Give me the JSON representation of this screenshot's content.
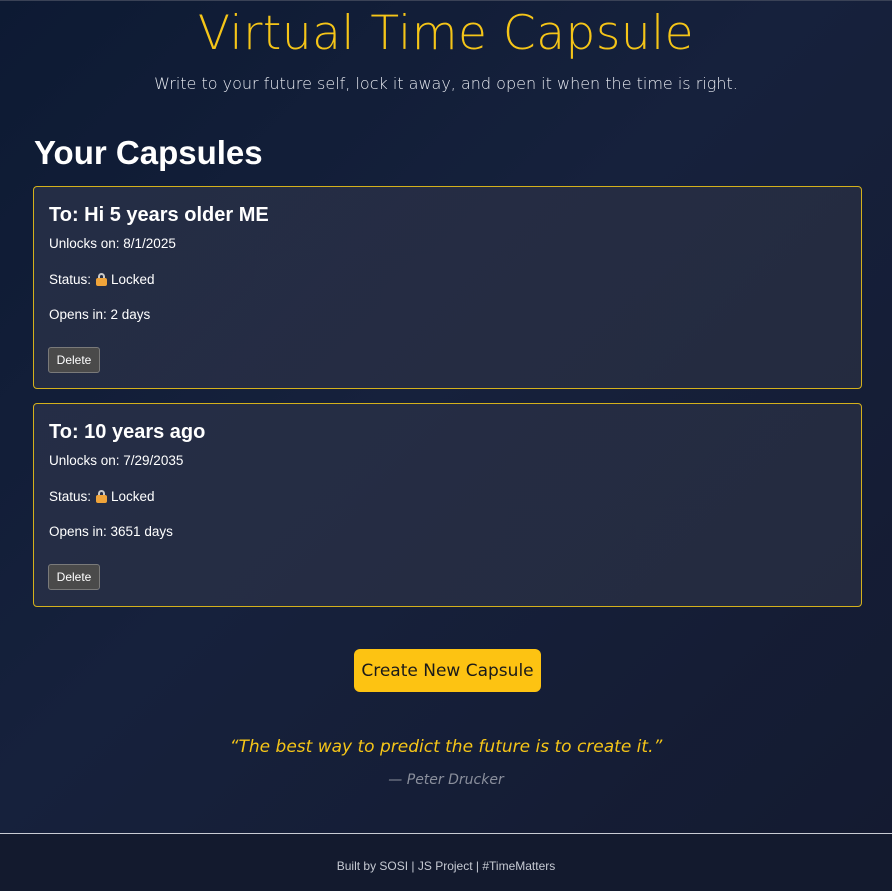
{
  "header": {
    "title": "Virtual Time Capsule",
    "subtitle": "Write to your future self, lock it away, and open it when the time is right."
  },
  "capsules_section": {
    "title": "Your Capsules",
    "items": [
      {
        "to": "To: Hi 5 years older ME",
        "unlocks": "Unlocks on: 8/1/2025",
        "status_label": "Status:",
        "status_value": "Locked",
        "status_icon": "lock-icon",
        "opens": "Opens in: 2 days",
        "delete_label": "Delete"
      },
      {
        "to": "To: 10 years ago",
        "unlocks": "Unlocks on: 7/29/2035",
        "status_label": "Status:",
        "status_value": "Locked",
        "status_icon": "lock-icon",
        "opens": "Opens in: 3651 days",
        "delete_label": "Delete"
      }
    ]
  },
  "actions": {
    "create_label": "Create New Capsule"
  },
  "quote": {
    "text": "“The best way to predict the future is to create it.”",
    "author": "— Peter Drucker"
  },
  "footer": {
    "text": "Built by SOSI | JS Project | #TimeMatters"
  },
  "colors": {
    "accent": "#fdc312",
    "card_border": "#d4b11c",
    "background": "#0d1a33"
  }
}
